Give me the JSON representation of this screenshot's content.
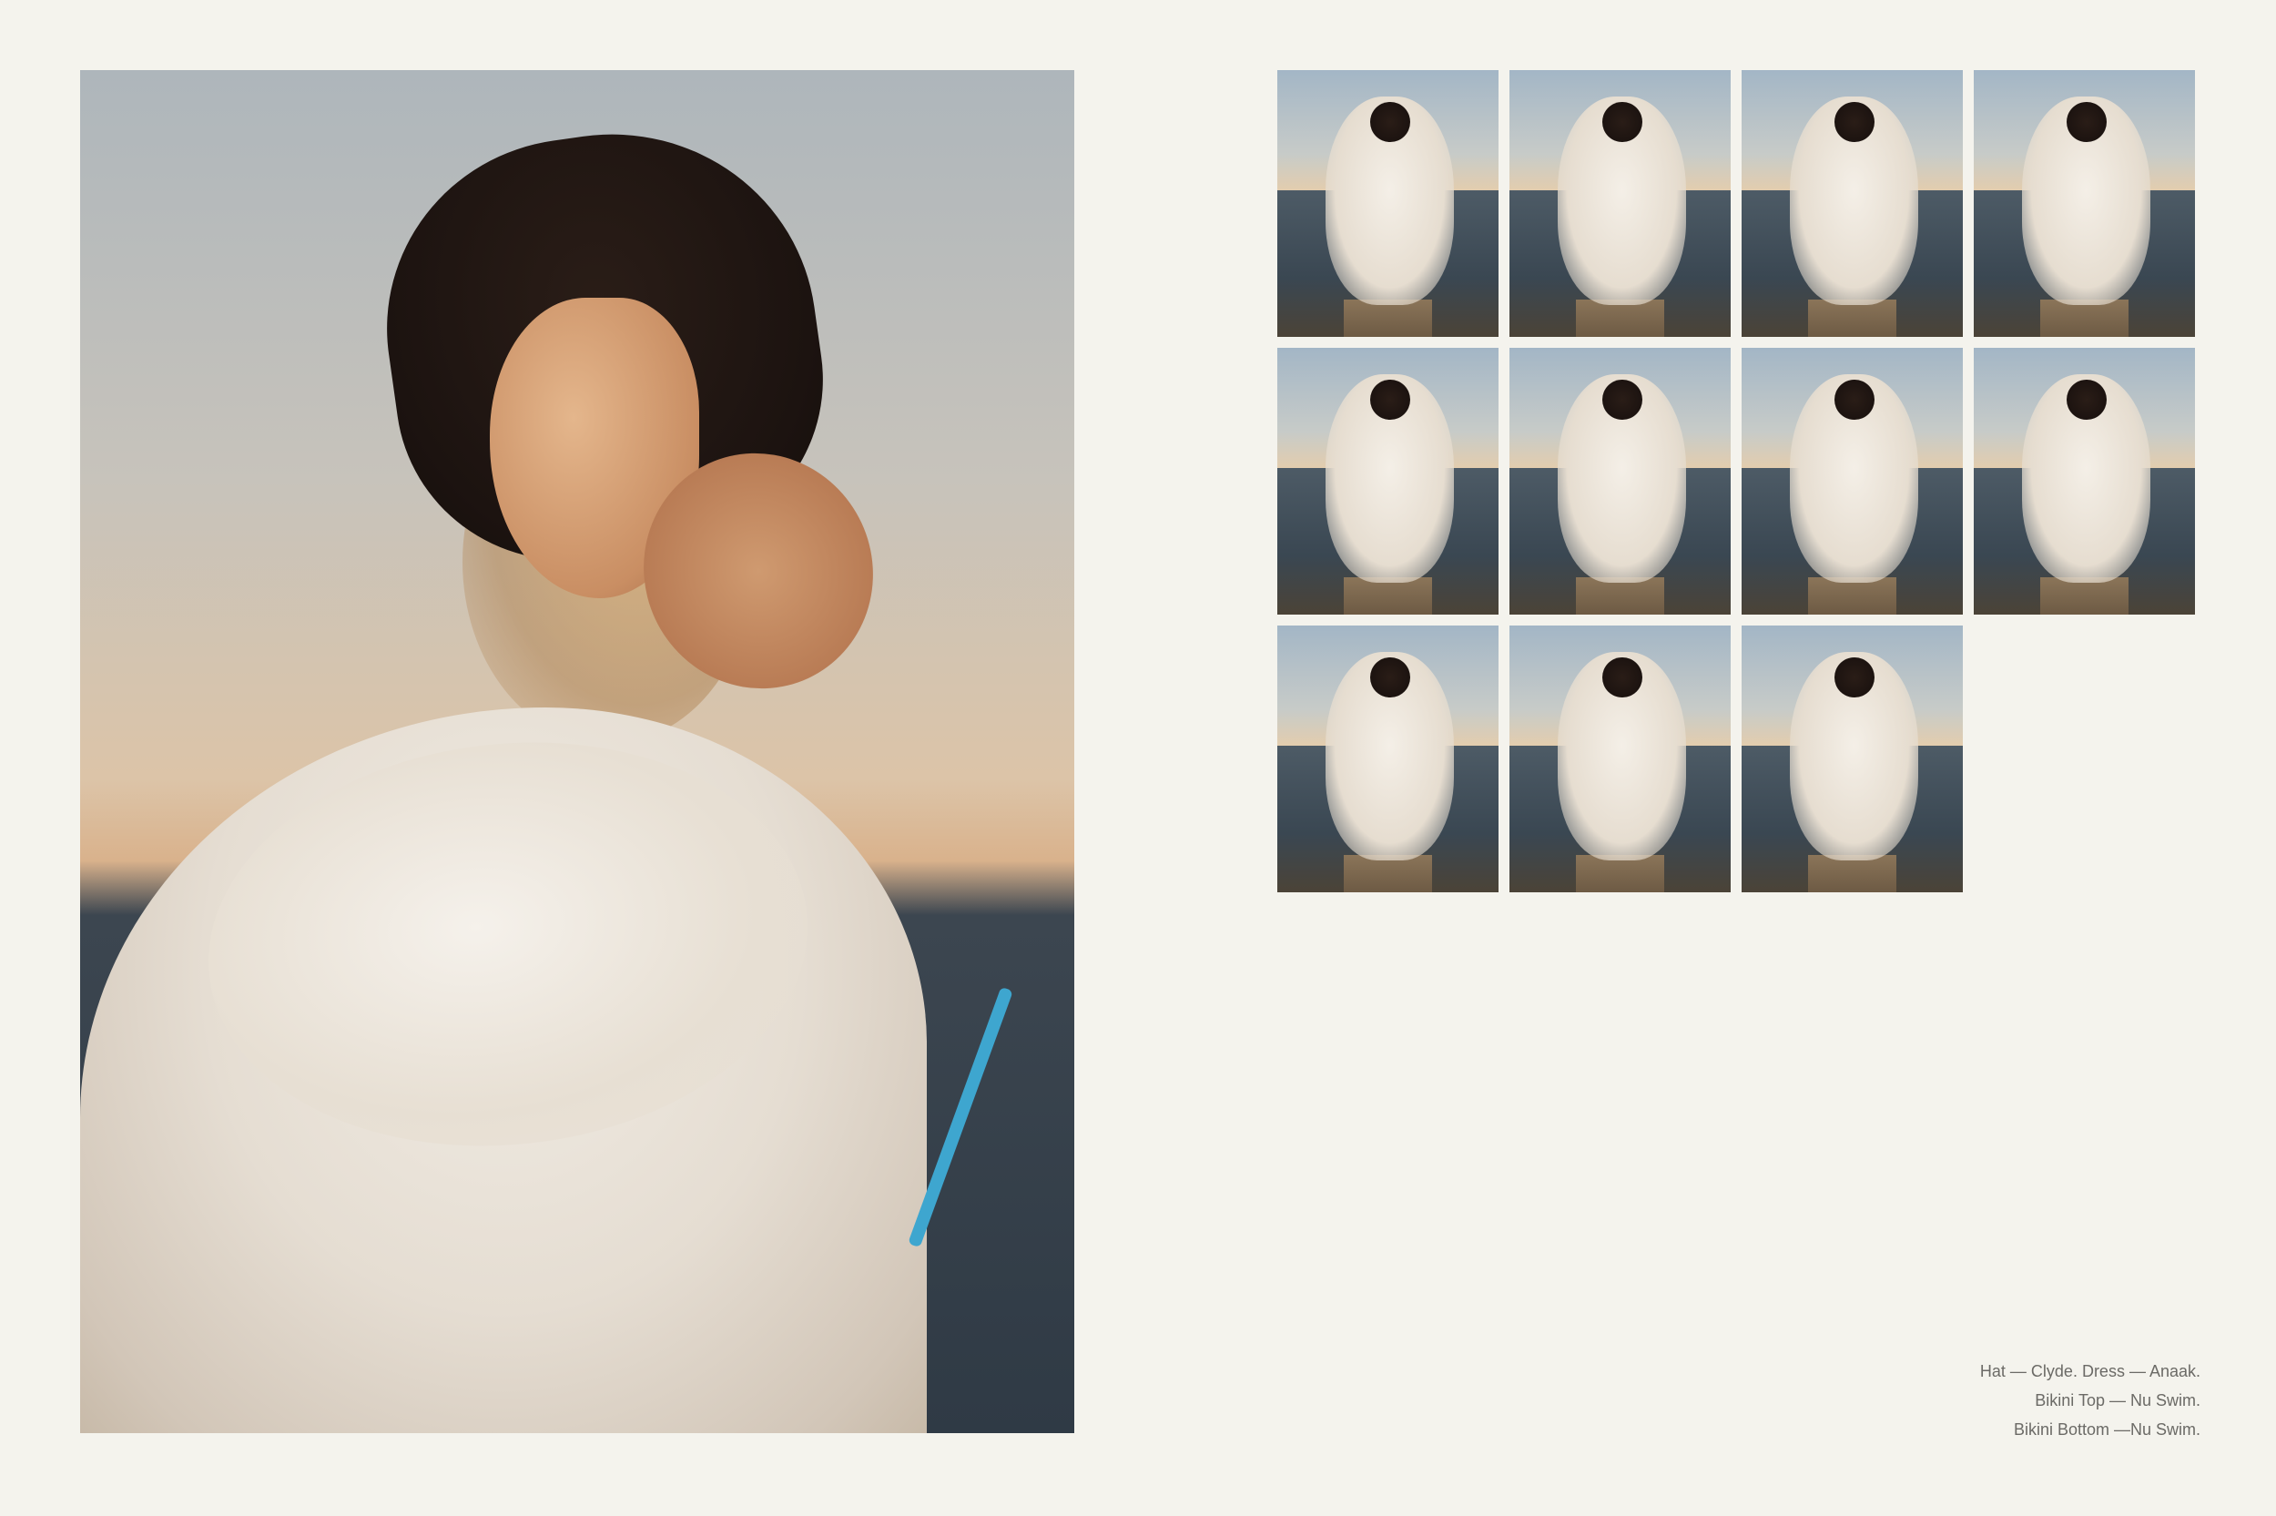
{
  "hero_photo": {
    "description_icon": "photo-icon"
  },
  "thumbnails": [
    {
      "name": "thumb-1"
    },
    {
      "name": "thumb-2"
    },
    {
      "name": "thumb-3"
    },
    {
      "name": "thumb-4"
    },
    {
      "name": "thumb-5"
    },
    {
      "name": "thumb-6"
    },
    {
      "name": "thumb-7"
    },
    {
      "name": "thumb-8"
    },
    {
      "name": "thumb-9"
    },
    {
      "name": "thumb-10"
    },
    {
      "name": "thumb-11"
    }
  ],
  "caption": {
    "line1": "Hat — Clyde.  Dress — Anaak.",
    "line2": "Bikini Top — Nu Swim.",
    "line3": "Bikini Bottom —Nu Swim."
  },
  "colors": {
    "background": "#f4f3ed",
    "caption_text": "#6b6a66",
    "accent_tie": "#3ea6cf"
  }
}
